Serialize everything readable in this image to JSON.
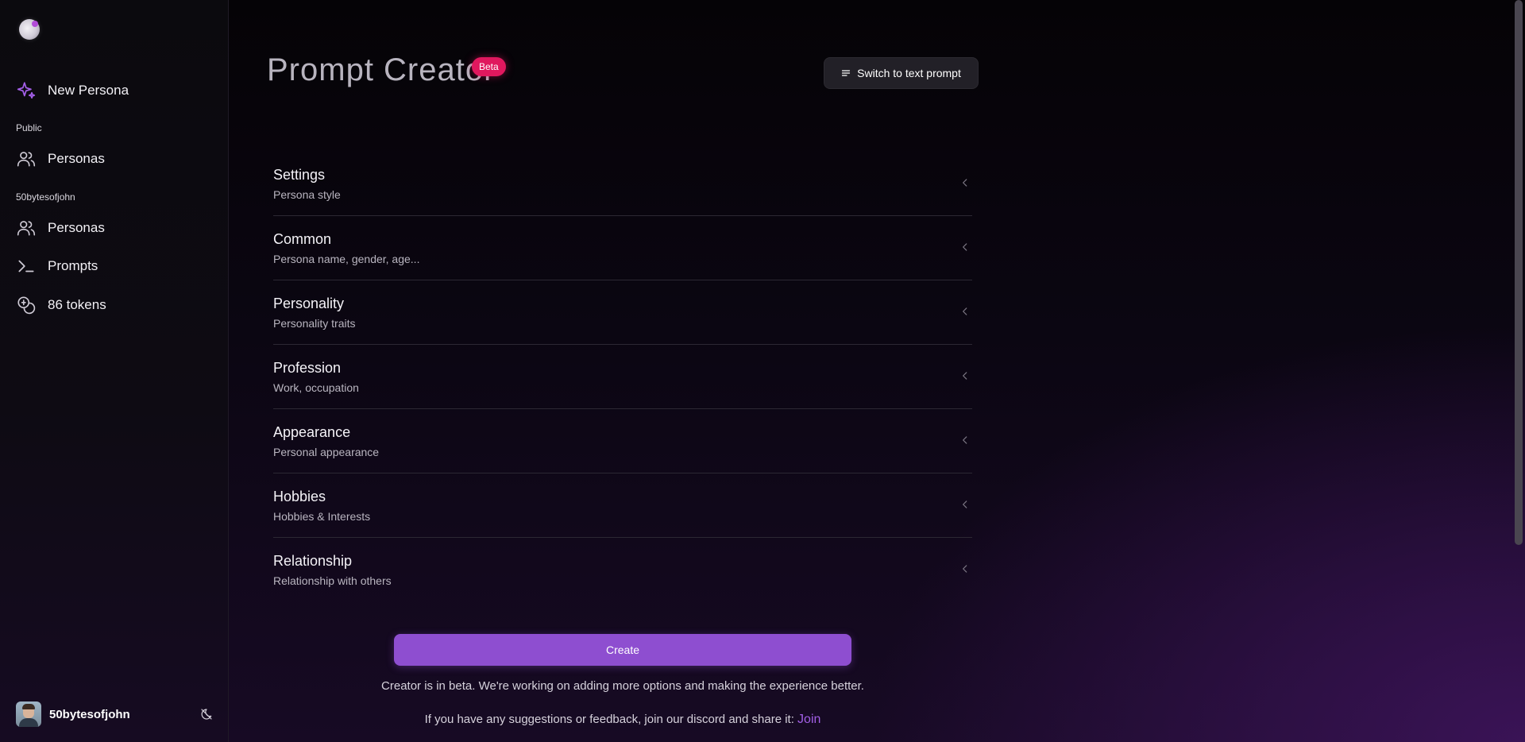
{
  "sidebar": {
    "new_persona": "New Persona",
    "public_label": "Public",
    "public_personas": "Personas",
    "user_section_label": "50bytesofjohn",
    "user_personas": "Personas",
    "prompts": "Prompts",
    "tokens": "86 tokens",
    "username": "50bytesofjohn"
  },
  "header": {
    "title": "Prompt Creator",
    "badge": "Beta",
    "switch_label": "Switch to text prompt"
  },
  "sections": [
    {
      "title": "Settings",
      "subtitle": "Persona style"
    },
    {
      "title": "Common",
      "subtitle": "Persona name, gender, age..."
    },
    {
      "title": "Personality",
      "subtitle": "Personality traits"
    },
    {
      "title": "Profession",
      "subtitle": "Work, occupation"
    },
    {
      "title": "Appearance",
      "subtitle": "Personal appearance"
    },
    {
      "title": "Hobbies",
      "subtitle": "Hobbies & Interests"
    },
    {
      "title": "Relationship",
      "subtitle": "Relationship with others"
    }
  ],
  "footer": {
    "create_label": "Create",
    "beta_note": "Creator is in beta. We're working on adding more options and making the experience better.",
    "feedback_note": "If you have any suggestions or feedback, join our discord and share it:",
    "join_link": "Join"
  },
  "colors": {
    "accent": "#8e4ed0",
    "badge": "#e0185e",
    "link": "#a25fe6"
  }
}
